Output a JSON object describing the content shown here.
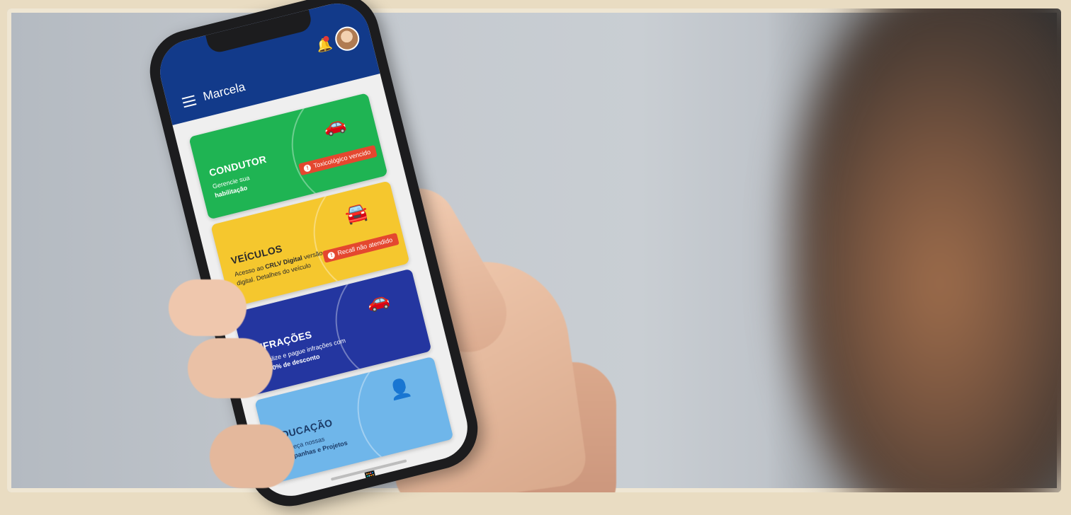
{
  "app": {
    "user_name": "Marcela",
    "notification_badge": "",
    "header_color": "#123a8a"
  },
  "cards": [
    {
      "title": "CONDUTOR",
      "desc_line1": "Gerencie sua",
      "desc_bold": "habilitação",
      "alert": "Toxicológico vencido",
      "icon": "car-person-icon",
      "color": "#1fb453"
    },
    {
      "title": "VEÍCULOS",
      "desc_line1": "Acesso ao",
      "desc_bold": "CRLV Digital",
      "desc_line2": "versão digital. Detalhes do veículo",
      "alert": "Recall não atendido",
      "icon": "car-icon",
      "color": "#f5c72e"
    },
    {
      "title": "INFRAÇÕES",
      "desc_line1": "Visualize e pague infrações com até",
      "desc_bold": "40% de desconto",
      "icon": "traffic-cars-icon",
      "color": "#2436a0"
    },
    {
      "title": "EDUCAÇÃO",
      "desc_line1": "Conheça nossas",
      "desc_bold": "Campanhas e Projetos",
      "icon": "presentation-icon",
      "color": "#6fb6ea"
    }
  ]
}
